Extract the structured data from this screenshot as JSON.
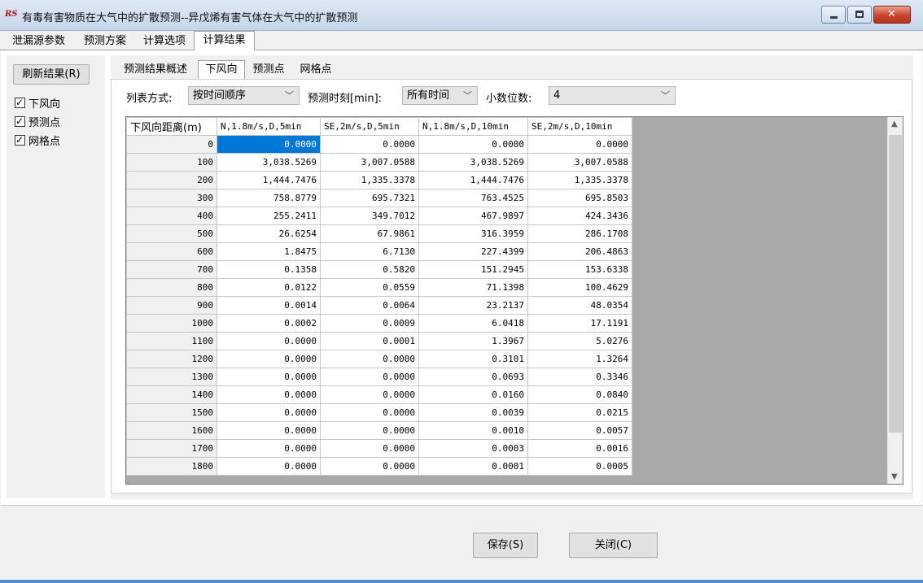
{
  "window": {
    "app_logo_text": "RS",
    "title": "有毒有害物质在大气中的扩散预测--异戊烯有害气体在大气中的扩散预测"
  },
  "top_tabs": [
    "泄漏源参数",
    "预测方案",
    "计算选项",
    "计算结果"
  ],
  "selected_top_tab": "计算结果",
  "left_panel": {
    "refresh_label": "刷新结果(R)",
    "checkboxes": [
      {
        "label": "下风向",
        "checked": true
      },
      {
        "label": "预测点",
        "checked": true
      },
      {
        "label": "网格点",
        "checked": true
      }
    ]
  },
  "sub_tabs": [
    "预测结果概述",
    "下风向",
    "预测点",
    "网格点"
  ],
  "selected_sub_tab": "下风向",
  "controls": {
    "list_mode_label": "列表方式:",
    "list_mode_value": "按时间顺序",
    "predict_time_label": "预测时刻[min]:",
    "predict_time_value": "所有时间",
    "decimals_label": "小数位数:",
    "decimals_value": "4"
  },
  "table": {
    "headers": [
      "下风向距离(m)",
      "N,1.8m/s,D,5min",
      "SE,2m/s,D,5min",
      "N,1.8m/s,D,10min",
      "SE,2m/s,D,10min"
    ],
    "rows": [
      [
        "0",
        "0.0000",
        "0.0000",
        "0.0000",
        "0.0000"
      ],
      [
        "100",
        "3,038.5269",
        "3,007.0588",
        "3,038.5269",
        "3,007.0588"
      ],
      [
        "200",
        "1,444.7476",
        "1,335.3378",
        "1,444.7476",
        "1,335.3378"
      ],
      [
        "300",
        "758.8779",
        "695.7321",
        "763.4525",
        "695.8503"
      ],
      [
        "400",
        "255.2411",
        "349.7012",
        "467.9897",
        "424.3436"
      ],
      [
        "500",
        "26.6254",
        "67.9861",
        "316.3959",
        "286.1708"
      ],
      [
        "600",
        "1.8475",
        "6.7130",
        "227.4399",
        "206.4863"
      ],
      [
        "700",
        "0.1358",
        "0.5820",
        "151.2945",
        "153.6338"
      ],
      [
        "800",
        "0.0122",
        "0.0559",
        "71.1398",
        "100.4629"
      ],
      [
        "900",
        "0.0014",
        "0.0064",
        "23.2137",
        "48.0354"
      ],
      [
        "1000",
        "0.0002",
        "0.0009",
        "6.0418",
        "17.1191"
      ],
      [
        "1100",
        "0.0000",
        "0.0001",
        "1.3967",
        "5.0276"
      ],
      [
        "1200",
        "0.0000",
        "0.0000",
        "0.3101",
        "1.3264"
      ],
      [
        "1300",
        "0.0000",
        "0.0000",
        "0.0693",
        "0.3346"
      ],
      [
        "1400",
        "0.0000",
        "0.0000",
        "0.0160",
        "0.0840"
      ],
      [
        "1500",
        "0.0000",
        "0.0000",
        "0.0039",
        "0.0215"
      ],
      [
        "1600",
        "0.0000",
        "0.0000",
        "0.0010",
        "0.0057"
      ],
      [
        "1700",
        "0.0000",
        "0.0000",
        "0.0003",
        "0.0016"
      ],
      [
        "1800",
        "0.0000",
        "0.0000",
        "0.0001",
        "0.0005"
      ]
    ]
  },
  "buttons": {
    "save_label": "保存(S)",
    "close_label": "关闭(C)"
  },
  "colors": {
    "selected_cell": "#0078d7",
    "grid_empty_area": "#a9a9a9"
  }
}
